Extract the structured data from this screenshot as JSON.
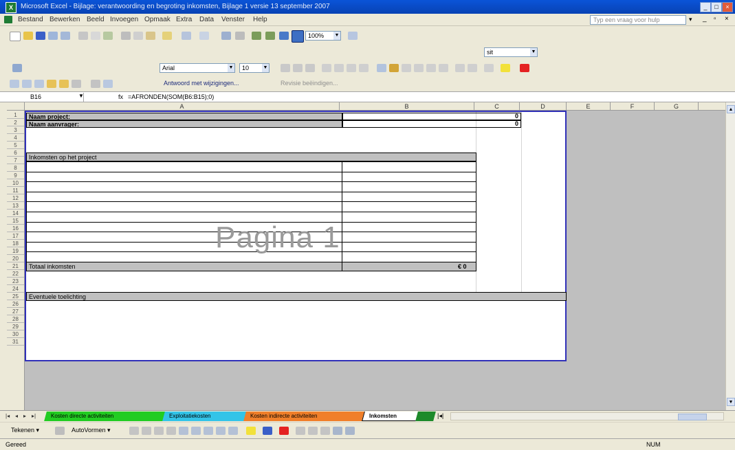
{
  "window": {
    "title": "Microsoft Excel - Bijlage: verantwoording en begroting inkomsten, Bijlage 1 versie 13 september 2007"
  },
  "menu": {
    "items": [
      "Bestand",
      "Bewerken",
      "Beeld",
      "Invoegen",
      "Opmaak",
      "Extra",
      "Data",
      "Venster",
      "Help"
    ],
    "help_placeholder": "Typ een vraag voor hulp"
  },
  "toolbar": {
    "zoom": "100%",
    "font_name": "Arial",
    "font_size": "10",
    "style_combo": "sit",
    "reply_label": "Antwoord met wijzigingen...",
    "end_review_label": "Revisie beëindigen..."
  },
  "formula_bar": {
    "cell_ref": "B16",
    "fx": "fx",
    "formula": "=AFRONDEN(SOM(B6:B15);0)"
  },
  "columns": [
    "A",
    "B",
    "C",
    "D",
    "E",
    "F",
    "G"
  ],
  "rows": [
    "1",
    "2",
    "3",
    "4",
    "5",
    "6",
    "7",
    "8",
    "9",
    "10",
    "11",
    "12",
    "13",
    "14",
    "15",
    "16",
    "17",
    "18",
    "19",
    "20",
    "21",
    "22",
    "23",
    "24",
    "25",
    "26",
    "27",
    "28",
    "29",
    "30",
    "31"
  ],
  "sheet": {
    "project_label": "Naam project:",
    "applicant_label": "Naam aanvrager:",
    "c1_value": "0",
    "c2_value": "0",
    "income_header": "Inkomsten op het project",
    "total_label": "Totaal inkomsten",
    "total_value": "€ 0",
    "notes_header": "Eventuele toelichting",
    "watermark": "Pagina 1"
  },
  "tabs": [
    {
      "label": "Kosten directe activiteiten",
      "color": "#22cc22"
    },
    {
      "label": "Exploitatiekosten",
      "color": "#33c4e8"
    },
    {
      "label": "Kosten indirecte activiteiten",
      "color": "#f07f2a"
    },
    {
      "label": "Inkomsten",
      "color": "#ffffff"
    },
    {
      "label": "",
      "color": "#1d8a2a"
    }
  ],
  "drawing": {
    "draw_label": "Tekenen",
    "autoshapes_label": "AutoVormen"
  },
  "status": {
    "left": "Gereed",
    "right": "NUM"
  }
}
